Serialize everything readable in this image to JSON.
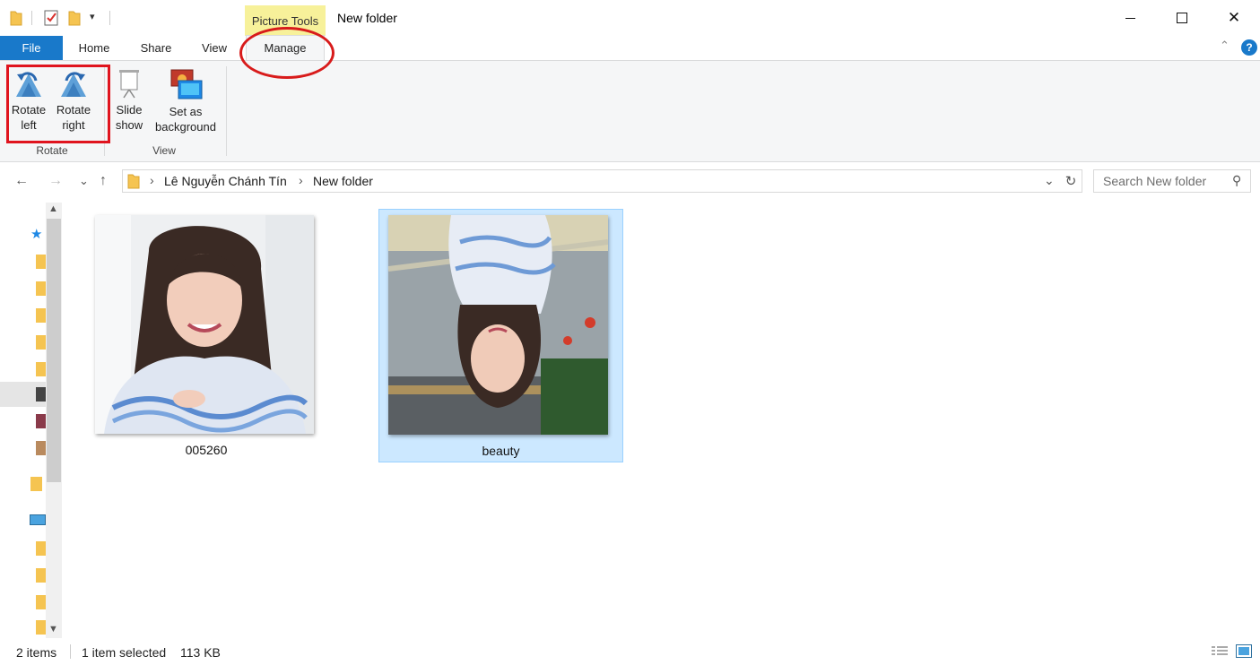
{
  "title_bar": {
    "context_tab_label": "Picture Tools",
    "window_title": "New folder",
    "minimize_glyph": "—",
    "maximize_glyph": "☐",
    "close_glyph": "✕",
    "qa_dropdown_glyph": "▾"
  },
  "ribbon_tabs": {
    "file": "File",
    "home": "Home",
    "share": "Share",
    "view": "View",
    "manage": "Manage",
    "help_glyph": "?",
    "collapse_glyph": "⌃"
  },
  "ribbon": {
    "rotate_group": {
      "label": "Rotate",
      "rotate_left": "Rotate\nleft",
      "rotate_right": "Rotate\nright"
    },
    "view_group": {
      "label": "View",
      "slide_show": "Slide\nshow",
      "set_background": "Set as\nbackground"
    }
  },
  "address_bar": {
    "back_glyph": "←",
    "forward_glyph": "→",
    "recent_glyph": "⌄",
    "up_glyph": "↑",
    "breadcrumb": [
      "Lê Nguyễn Chánh Tín",
      "New folder"
    ],
    "separator_glyph": "›",
    "dropdown_glyph": "⌄",
    "refresh_glyph": "↻",
    "search_placeholder": "Search New folder",
    "search_glyph": "⚲"
  },
  "files": [
    {
      "name": "005260",
      "selected": false
    },
    {
      "name": "beauty",
      "selected": true
    }
  ],
  "status_bar": {
    "item_count": "2 items",
    "selection": "1 item selected",
    "size": "113 KB"
  },
  "colors": {
    "file_tab": "#1979ca",
    "context_tab": "#f7f19a",
    "selection_bg": "#cce8ff",
    "selection_border": "#99d1ff",
    "annotation_red": "#e0141e"
  }
}
